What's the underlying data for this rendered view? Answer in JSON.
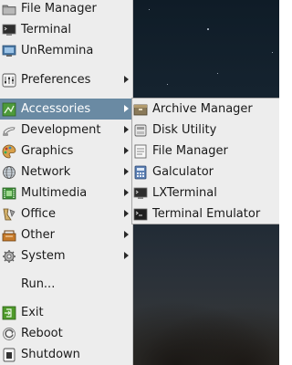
{
  "main_menu": {
    "items": [
      {
        "label": "File Manager",
        "icon": "folder-icon",
        "has_submenu": false
      },
      {
        "label": "Terminal",
        "icon": "terminal-icon",
        "has_submenu": false
      },
      {
        "label": "UnRemmina",
        "icon": "remote-desktop-icon",
        "has_submenu": false
      },
      {
        "label": "Preferences",
        "icon": "preferences-icon",
        "has_submenu": true
      },
      {
        "label": "Accessories",
        "icon": "accessories-icon",
        "has_submenu": true,
        "active": true
      },
      {
        "label": "Development",
        "icon": "development-icon",
        "has_submenu": true
      },
      {
        "label": "Graphics",
        "icon": "graphics-icon",
        "has_submenu": true
      },
      {
        "label": "Network",
        "icon": "network-icon",
        "has_submenu": true
      },
      {
        "label": "Multimedia",
        "icon": "multimedia-icon",
        "has_submenu": true
      },
      {
        "label": "Office",
        "icon": "office-icon",
        "has_submenu": true
      },
      {
        "label": "Other",
        "icon": "other-icon",
        "has_submenu": true
      },
      {
        "label": "System",
        "icon": "system-icon",
        "has_submenu": true
      },
      {
        "label": "Run...",
        "icon": "",
        "has_submenu": false
      },
      {
        "label": "Exit",
        "icon": "exit-icon",
        "has_submenu": false
      },
      {
        "label": "Reboot",
        "icon": "reboot-icon",
        "has_submenu": false
      },
      {
        "label": "Shutdown",
        "icon": "shutdown-icon",
        "has_submenu": false
      }
    ]
  },
  "accessories_submenu": {
    "items": [
      {
        "label": "Archive Manager",
        "icon": "archive-icon"
      },
      {
        "label": "Disk Utility",
        "icon": "disk-icon"
      },
      {
        "label": "File Manager",
        "icon": "file-manager-icon"
      },
      {
        "label": "Galculator",
        "icon": "calculator-icon"
      },
      {
        "label": "LXTerminal",
        "icon": "lxterminal-icon"
      },
      {
        "label": "Terminal Emulator",
        "icon": "terminal-emulator-icon"
      }
    ]
  },
  "colors": {
    "menu_bg": "#ededed",
    "highlight": "#6a8aa3"
  }
}
